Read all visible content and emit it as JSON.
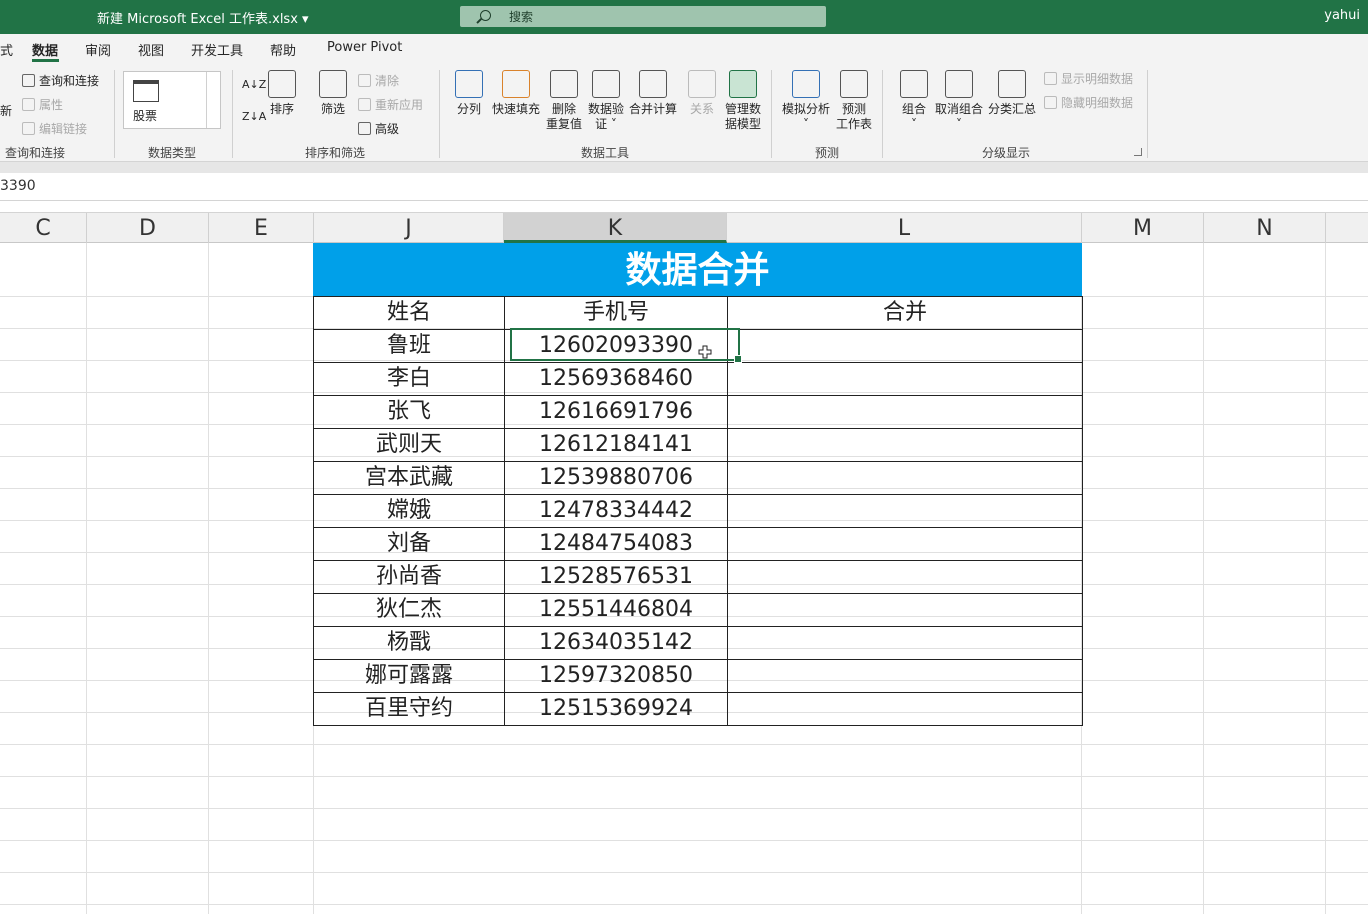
{
  "window": {
    "title": "新建 Microsoft Excel 工作表.xlsx",
    "search_placeholder": "搜索",
    "user": "yahui"
  },
  "tabs": [
    {
      "label": "式"
    },
    {
      "label": "数据"
    },
    {
      "label": "审阅"
    },
    {
      "label": "视图"
    },
    {
      "label": "开发工具"
    },
    {
      "label": "帮助"
    },
    {
      "label": "Power Pivot"
    }
  ],
  "ribbon": {
    "query": {
      "refresh": "新",
      "query_conn": "查询和连接",
      "properties": "属性",
      "edit_links": "编辑链接",
      "group": "查询和连接"
    },
    "datatype": {
      "stock": "股票",
      "group": "数据类型"
    },
    "sort": {
      "sort": "排序",
      "filter": "筛选",
      "clear": "清除",
      "reapply": "重新应用",
      "advanced": "高级",
      "group": "排序和筛选"
    },
    "tools": {
      "split_label": "分列",
      "flash_fill": "快速填充",
      "remove_dup_1": "删除",
      "remove_dup_2": "重复值",
      "validate_1": "数据验",
      "validate_2": "证 ˅",
      "consolidate": "合并计算",
      "relations": "关系",
      "model_1": "管理数",
      "model_2": "据模型",
      "group": "数据工具"
    },
    "forecast": {
      "whatif": "模拟分析",
      "whatif_caret": "˅",
      "sheet_1": "预测",
      "sheet_2": "工作表",
      "group": "预测"
    },
    "outline": {
      "group_btn": "组合",
      "ungroup": "取消组合",
      "subtotal": "分类汇总",
      "caret": "˅",
      "show": "显示明细数据",
      "hide": "隐藏明细数据",
      "group": "分级显示"
    }
  },
  "formula_bar": {
    "value": "3390"
  },
  "columns": [
    "C",
    "D",
    "E",
    "J",
    "K",
    "L",
    "M",
    "N"
  ],
  "table": {
    "title": "数据合并",
    "headers": [
      "姓名",
      "手机号",
      "合并"
    ],
    "rows": [
      {
        "name": "鲁班",
        "phone": "12602093390"
      },
      {
        "name": "李白",
        "phone": "12569368460"
      },
      {
        "name": "张飞",
        "phone": "12616691796"
      },
      {
        "name": "武则天",
        "phone": "12612184141"
      },
      {
        "name": "宫本武藏",
        "phone": "12539880706"
      },
      {
        "name": "嫦娥",
        "phone": "12478334442"
      },
      {
        "name": "刘备",
        "phone": "12484754083"
      },
      {
        "name": "孙尚香",
        "phone": "12528576531"
      },
      {
        "name": "狄仁杰",
        "phone": "12551446804"
      },
      {
        "name": "杨戬",
        "phone": "12634035142"
      },
      {
        "name": "娜可露露",
        "phone": "12597320850"
      },
      {
        "name": "百里守约",
        "phone": "12515369924"
      }
    ]
  },
  "colors": {
    "excel_green": "#217346",
    "title_fill": "#00a0e9"
  }
}
